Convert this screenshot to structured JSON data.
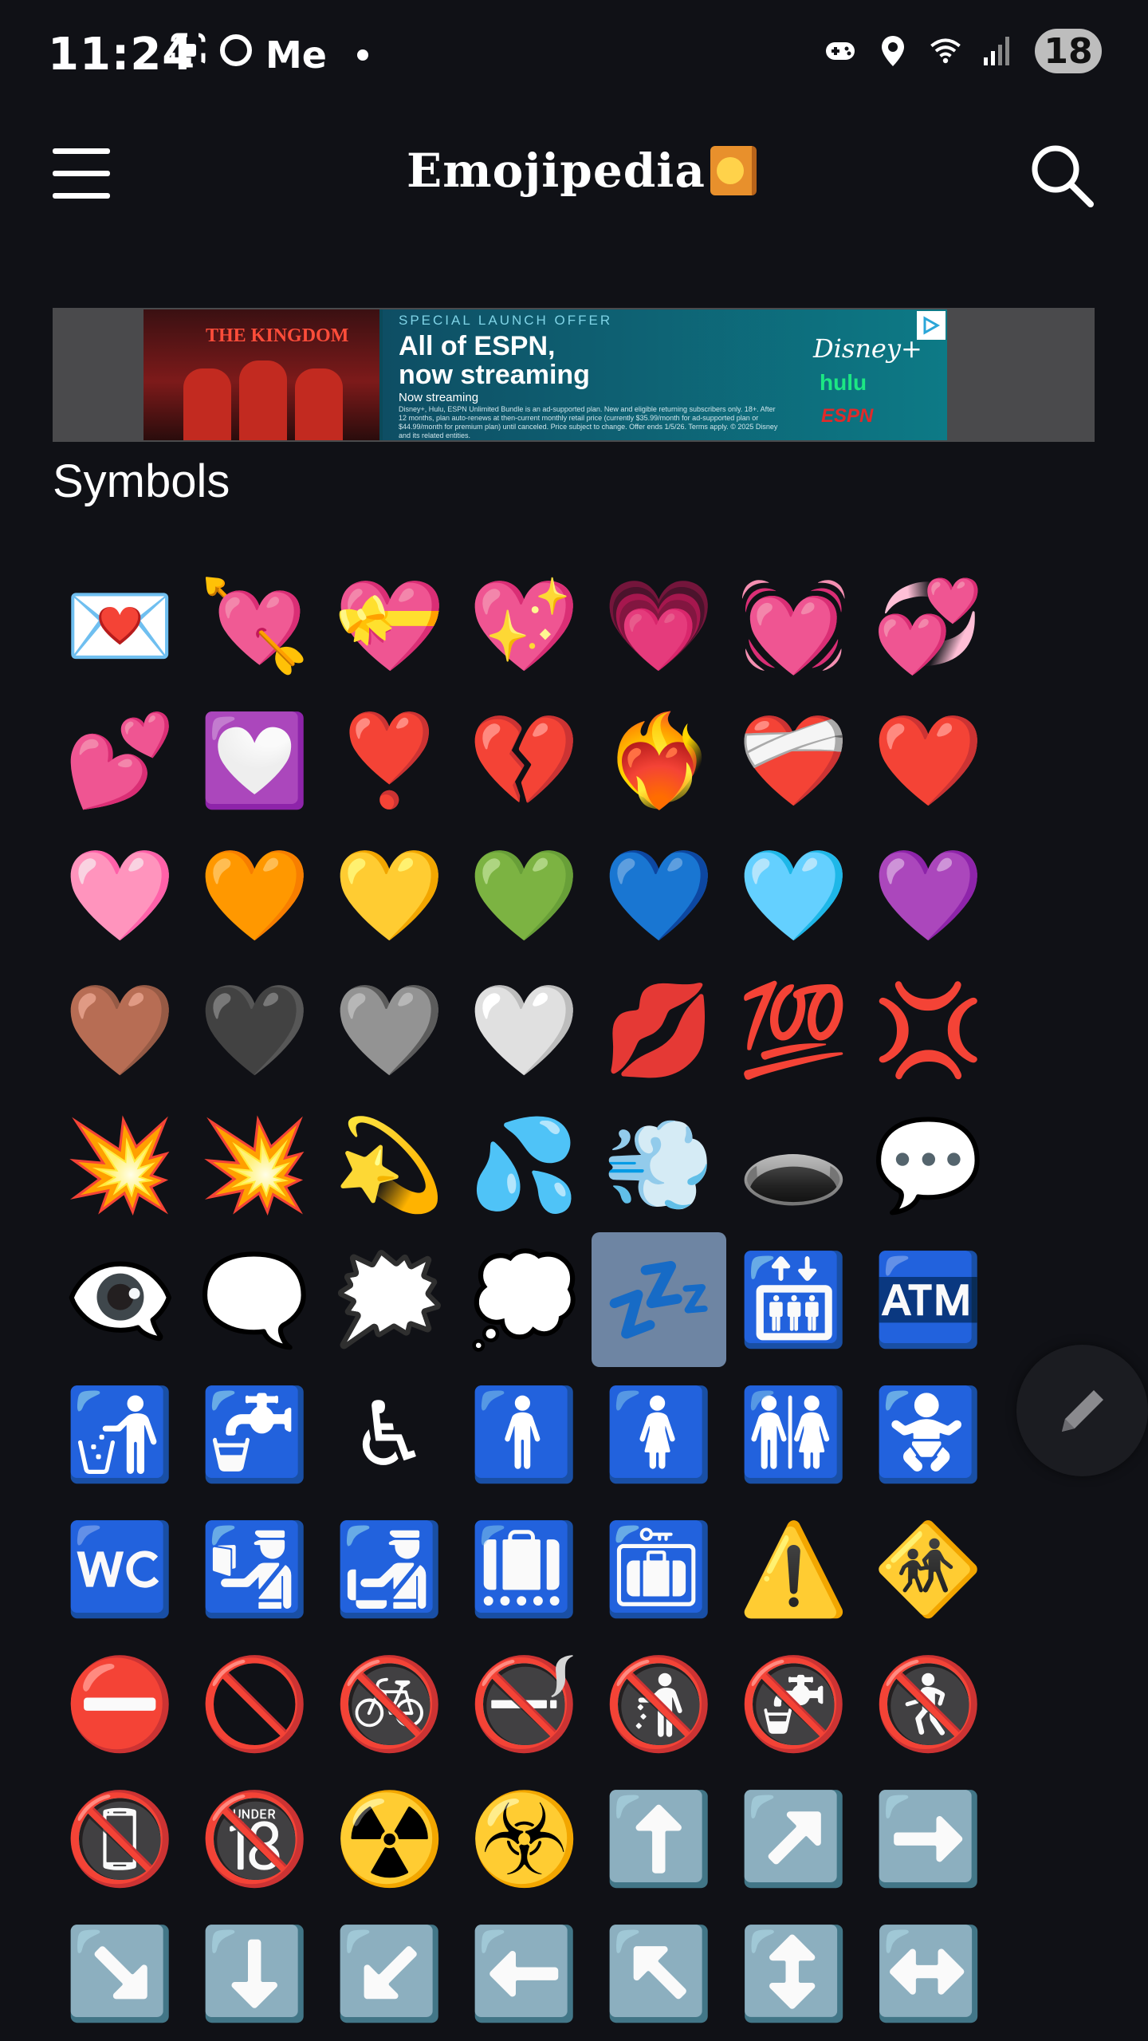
{
  "status_bar": {
    "time": "11:24",
    "left_text": "Me",
    "battery": "18"
  },
  "header": {
    "brand": "Emojipedia",
    "menu_icon": "hamburger-menu-icon",
    "search_icon": "search-icon"
  },
  "ad": {
    "image_title": "THE KINGDOM",
    "offer": "SPECIAL LAUNCH OFFER",
    "headline_1": "All of ESPN,",
    "headline_2": "now streaming",
    "sub": "Now streaming",
    "fine_print": "Disney+, Hulu, ESPN Unlimited Bundle is an ad-supported plan. New and eligible returning subscribers only. 18+. After 12 months, plan auto-renews at then-current monthly retail price (currently $35.99/month for ad-supported plan or $44.99/month for premium plan) until canceled. Price subject to change. Offer ends 1/5/26. Terms apply. © 2025 Disney and its related entities.",
    "disney": "Disney+",
    "hulu": "hulu",
    "espn": "ESPN"
  },
  "section": {
    "title": "Symbols"
  },
  "emojis": [
    "💌",
    "💘",
    "💝",
    "💖",
    "💗",
    "💓",
    "💞",
    "💕",
    "💟",
    "❣️",
    "💔",
    "❤️‍🔥",
    "❤️‍🩹",
    "❤️",
    "🩷",
    "🧡",
    "💛",
    "💚",
    "💙",
    "🩵",
    "💜",
    "🤎",
    "🖤",
    "🩶",
    "🤍",
    "💋",
    "💯",
    "💢",
    "💥",
    "💥",
    "💫",
    "💦",
    "💨",
    "🕳️",
    "💬",
    "👁️‍🗨️",
    "🗨️",
    "🗯️",
    "💭",
    "💤",
    "🛗",
    "🏧",
    "🚮",
    "🚰",
    "♿",
    "🚹",
    "🚺",
    "🚻",
    "🚼",
    "🚾",
    "🛂",
    "🛃",
    "🛄",
    "🛅",
    "⚠️",
    "🚸",
    "⛔",
    "🚫",
    "🚳",
    "🚭",
    "🚯",
    "🚱",
    "🚷",
    "📵",
    "🔞",
    "☢️",
    "☣️",
    "⬆️",
    "↗️",
    "➡️",
    "↘️",
    "⬇️",
    "↙️",
    "⬅️",
    "↖️",
    "↕️",
    "↔️"
  ],
  "selected_index": 39,
  "fab_icon": "pencil-icon"
}
